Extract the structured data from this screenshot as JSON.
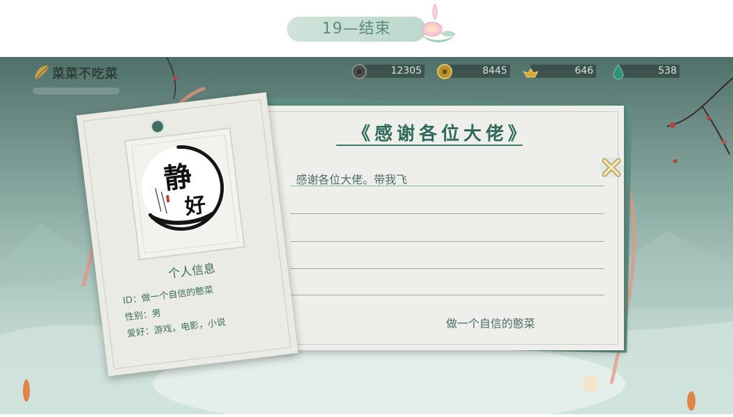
{
  "banner": {
    "title": "19—结束"
  },
  "logo": {
    "text": "菜菜不吃菜"
  },
  "currencies": [
    {
      "icon": "silver-coin-icon",
      "value": "12305"
    },
    {
      "icon": "gold-coin-icon",
      "value": "8445"
    },
    {
      "icon": "gold-ingot-icon",
      "value": "646"
    },
    {
      "icon": "jade-drop-icon",
      "value": "538"
    }
  ],
  "letter": {
    "title": "《感谢各位大佬》",
    "body": "感谢各位大佬。带我飞",
    "signature": "做一个自信的憨菜"
  },
  "profile": {
    "avatar_chars": [
      "静",
      "好"
    ],
    "heading": "个人信息",
    "id_line": "ID：做一个自信的憨菜",
    "gender_line": "性别：男",
    "hobby_line": "爱好：游戏，电影，小说"
  },
  "colors": {
    "accent": "#3c7a69",
    "banner": "#c7ded4",
    "ribbon": "#e8937c"
  }
}
